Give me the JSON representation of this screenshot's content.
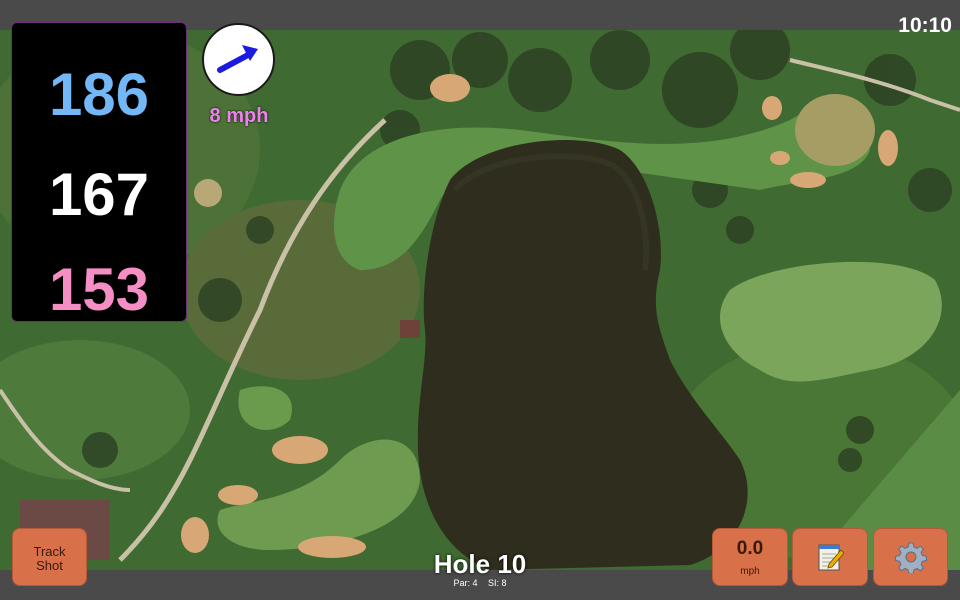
{
  "status": {
    "time": "10:10"
  },
  "distances": {
    "back": "186",
    "middle": "167",
    "front": "153"
  },
  "wind": {
    "speed_text": "8 mph",
    "direction_icon": "arrow-icon",
    "arrow_color": "#1a1ae0"
  },
  "hole": {
    "title": "Hole 10",
    "par": "Par: 4",
    "stroke_index": "SI: 8"
  },
  "buttons": {
    "track_shot_line1": "Track",
    "track_shot_line2": "Shot",
    "speed_value": "0.0",
    "speed_unit": "mph",
    "notes_icon": "notepad-icon",
    "settings_icon": "gear-icon"
  },
  "colors": {
    "button": "#d8704a",
    "back_distance": "#73b7f6",
    "front_distance": "#f58ec4",
    "wind_text": "#ee80ee"
  }
}
